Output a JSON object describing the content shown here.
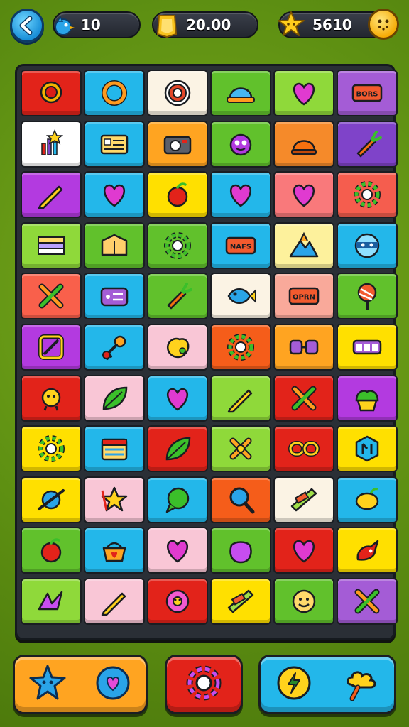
{
  "header": {
    "back_icon": "back-arrow-icon",
    "lives": {
      "icon": "blue-bird-icon",
      "value": "10"
    },
    "coins": {
      "icon": "gold-card-icon",
      "value": "20.00"
    },
    "stars": {
      "icon": "star-icon",
      "value": "5610"
    },
    "profile_icon": "smiley-face-icon"
  },
  "board": {
    "rows": 12,
    "cols": 6,
    "tiles": [
      {
        "color": "#e2231a",
        "icon": "red-badge-icon",
        "glyph": "badge"
      },
      {
        "color": "#23b7ea",
        "icon": "orange-ring-icon",
        "glyph": "ring"
      },
      {
        "color": "#fbf3e4",
        "icon": "target-icon",
        "glyph": "target"
      },
      {
        "color": "#61c12c",
        "icon": "blue-hat-icon",
        "glyph": "hat"
      },
      {
        "color": "#8fd93a",
        "icon": "broken-heart-icon",
        "glyph": "heart"
      },
      {
        "color": "#a45cd6",
        "icon": "sign-board-icon",
        "glyph": "sign",
        "text": "BORS"
      },
      {
        "color": "#ffffff",
        "icon": "star-chart-icon",
        "glyph": "chart"
      },
      {
        "color": "#23b7ea",
        "icon": "id-card-icon",
        "glyph": "card"
      },
      {
        "color": "#ffa421",
        "icon": "camera-icon",
        "glyph": "camera"
      },
      {
        "color": "#61c12c",
        "icon": "purple-monster-icon",
        "glyph": "monster"
      },
      {
        "color": "#f58a2a",
        "icon": "helmet-icon",
        "glyph": "helmet"
      },
      {
        "color": "#7f43c9",
        "icon": "carrot-icon",
        "glyph": "carrot"
      },
      {
        "color": "#b33ae0",
        "icon": "pencil-icon",
        "glyph": "pencil"
      },
      {
        "color": "#23b7ea",
        "icon": "purple-heart-icon",
        "glyph": "heart"
      },
      {
        "color": "#ffe000",
        "icon": "red-fruit-icon",
        "glyph": "fruit"
      },
      {
        "color": "#23b7ea",
        "icon": "purple-heart-icon",
        "glyph": "heart"
      },
      {
        "color": "#f9797b",
        "icon": "red-heart-icon",
        "glyph": "heart"
      },
      {
        "color": "#f55d4e",
        "icon": "green-gear-icon",
        "glyph": "gear"
      },
      {
        "color": "#8fd93a",
        "icon": "striped-flag-icon",
        "glyph": "flag"
      },
      {
        "color": "#61c12c",
        "icon": "map-box-icon",
        "glyph": "box"
      },
      {
        "color": "#61c12c",
        "icon": "gears-icon",
        "glyph": "gear"
      },
      {
        "color": "#23b7ea",
        "icon": "red-label-icon",
        "glyph": "sign",
        "text": "NAFS"
      },
      {
        "color": "#fdf19c",
        "icon": "mountain-icon",
        "glyph": "mountain"
      },
      {
        "color": "#23b7ea",
        "icon": "ninja-face-icon",
        "glyph": "ninja"
      },
      {
        "color": "#f9604b",
        "icon": "crossed-arrow-icon",
        "glyph": "cross"
      },
      {
        "color": "#23b7ea",
        "icon": "purple-radio-icon",
        "glyph": "radio"
      },
      {
        "color": "#61c12c",
        "icon": "red-carrot-icon",
        "glyph": "carrot"
      },
      {
        "color": "#fbf3e4",
        "icon": "blue-fish-icon",
        "glyph": "fish"
      },
      {
        "color": "#f9a99a",
        "icon": "green-ticket-icon",
        "glyph": "sign",
        "text": "OPRN"
      },
      {
        "color": "#61c12c",
        "icon": "lollipop-icon",
        "glyph": "lollipop"
      },
      {
        "color": "#b33ae0",
        "icon": "framed-slash-icon",
        "glyph": "frame"
      },
      {
        "color": "#23b7ea",
        "icon": "orange-key-icon",
        "glyph": "key"
      },
      {
        "color": "#f9c6d6",
        "icon": "yellow-blob-icon",
        "glyph": "blob"
      },
      {
        "color": "#f55d1a",
        "icon": "green-sun-icon",
        "glyph": "gear"
      },
      {
        "color": "#ffa421",
        "icon": "purple-dice-icon",
        "glyph": "dice"
      },
      {
        "color": "#ffe000",
        "icon": "battery-icon",
        "glyph": "battery"
      },
      {
        "color": "#e2231a",
        "icon": "yellow-chick-icon",
        "glyph": "chick"
      },
      {
        "color": "#f9c6d6",
        "icon": "green-leaf-icon",
        "glyph": "leaf"
      },
      {
        "color": "#23b7ea",
        "icon": "heart-pin-icon",
        "glyph": "heart"
      },
      {
        "color": "#8fd93a",
        "icon": "blue-pencil-icon",
        "glyph": "pencil"
      },
      {
        "color": "#e2231a",
        "icon": "crossed-tools-icon",
        "glyph": "cross"
      },
      {
        "color": "#b33ae0",
        "icon": "cupcake-icon",
        "glyph": "cupcake"
      },
      {
        "color": "#ffe000",
        "icon": "sunburst-icon",
        "glyph": "gear"
      },
      {
        "color": "#23b7ea",
        "icon": "calendar-icon",
        "glyph": "calendar"
      },
      {
        "color": "#e2231a",
        "icon": "blue-feather-icon",
        "glyph": "leaf"
      },
      {
        "color": "#8fd93a",
        "icon": "orange-bone-icon",
        "glyph": "bone"
      },
      {
        "color": "#e2231a",
        "icon": "chain-link-icon",
        "glyph": "chain"
      },
      {
        "color": "#ffe000",
        "icon": "hexagon-shield-icon",
        "glyph": "hexagon"
      },
      {
        "color": "#ffe000",
        "icon": "blue-planet-icon",
        "glyph": "planet"
      },
      {
        "color": "#f9c6d6",
        "icon": "yellow-star-cup-icon",
        "glyph": "star"
      },
      {
        "color": "#23b7ea",
        "icon": "green-speech-icon",
        "glyph": "speech"
      },
      {
        "color": "#f55d1a",
        "icon": "magnifier-icon",
        "glyph": "magnifier"
      },
      {
        "color": "#fbf3e4",
        "icon": "green-plank-icon",
        "glyph": "plank"
      },
      {
        "color": "#23b7ea",
        "icon": "yellow-lemon-icon",
        "glyph": "lemon"
      },
      {
        "color": "#61c12c",
        "icon": "red-apple-icon",
        "glyph": "fruit"
      },
      {
        "color": "#23b7ea",
        "icon": "orange-basket-icon",
        "glyph": "basket"
      },
      {
        "color": "#f9c6d6",
        "icon": "purple-heart-pin-icon",
        "glyph": "heart"
      },
      {
        "color": "#61c12c",
        "icon": "purple-bag-icon",
        "glyph": "bag"
      },
      {
        "color": "#e2231a",
        "icon": "red-heart-icon",
        "glyph": "heart"
      },
      {
        "color": "#ffe000",
        "icon": "red-bird-icon",
        "glyph": "bird"
      },
      {
        "color": "#8fd93a",
        "icon": "purple-wave-icon",
        "glyph": "wave"
      },
      {
        "color": "#f9c6d6",
        "icon": "pen-icon",
        "glyph": "pencil"
      },
      {
        "color": "#e2231a",
        "icon": "pink-donut-icon",
        "glyph": "donut"
      },
      {
        "color": "#ffe000",
        "icon": "blue-bar-icon",
        "glyph": "plank"
      },
      {
        "color": "#61c12c",
        "icon": "yellow-smiley-icon",
        "glyph": "smiley"
      },
      {
        "color": "#a45cd6",
        "icon": "crossed-sticks-icon",
        "glyph": "cross"
      }
    ]
  },
  "bottom_bar": {
    "left_button": {
      "color": "#ffa421",
      "icons": [
        "blue-star-icon",
        "heart-bubble-icon"
      ]
    },
    "center_button": {
      "color": "#e2231a",
      "icons": [
        "gear-swirl-icon"
      ]
    },
    "right_button": {
      "color": "#23b7ea",
      "icons": [
        "yellow-coin-icon",
        "yellow-cloud-icon"
      ]
    }
  }
}
